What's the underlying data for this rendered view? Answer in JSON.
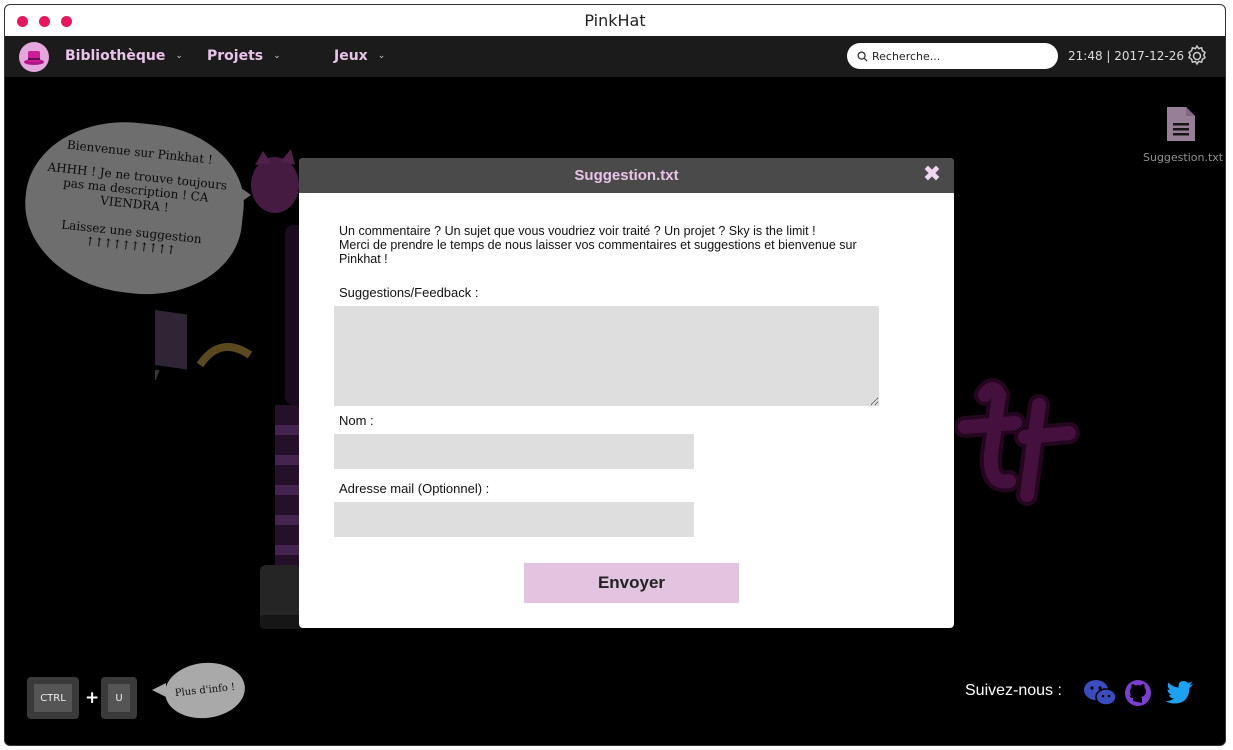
{
  "window": {
    "title": "PinkHat"
  },
  "nav": {
    "items": [
      {
        "label": "Bibliothèque",
        "chevron": "⌄"
      },
      {
        "label": "Projets",
        "chevron": "⌄"
      },
      {
        "label": "Jeux",
        "chevron": "⌄"
      }
    ],
    "search_placeholder": "Recherche...",
    "datetime": "21:48 | 2017-12-26"
  },
  "desktop": {
    "file_label": "Suggestion.txt"
  },
  "speech_bubble": {
    "line1": "Bienvenue sur Pinkhat !",
    "line2": "AHHH ! Je ne trouve toujours pas ma description ! CA VIENDRA !",
    "line3": "Laissez une suggestion",
    "arrows": "↑↑↑↑↑↑↑↑↑↑"
  },
  "modal": {
    "title": "Suggestion.txt",
    "close_glyph": "✖",
    "intro_line1": "Un commentaire ? Un sujet que vous voudriez voir traité ? Un projet ? Sky is the limit !",
    "intro_line2": "Merci de prendre le temps de nous laisser vos commentaires et suggestions et bienvenue sur Pinkhat !",
    "feedback_label": "Suggestions/Feedback :",
    "name_label": "Nom :",
    "email_label": "Adresse mail (Optionnel) :",
    "submit_label": "Envoyer"
  },
  "footer": {
    "key1": "CTRL",
    "plus": "+",
    "key2": "U",
    "hint": "Plus d'info !",
    "follow_label": "Suivez-nous :"
  },
  "colors": {
    "accent": "#e8175d",
    "nav_text": "#e8c4e8",
    "button": "#e2c4e0",
    "github": "#7a3fd0",
    "twitter": "#1da1f2",
    "wechat": "#3b4cc0"
  },
  "icons": [
    "hat-logo-icon",
    "search-icon",
    "gear-icon",
    "file-icon",
    "close-icon",
    "wechat-icon",
    "github-icon",
    "twitter-icon"
  ]
}
